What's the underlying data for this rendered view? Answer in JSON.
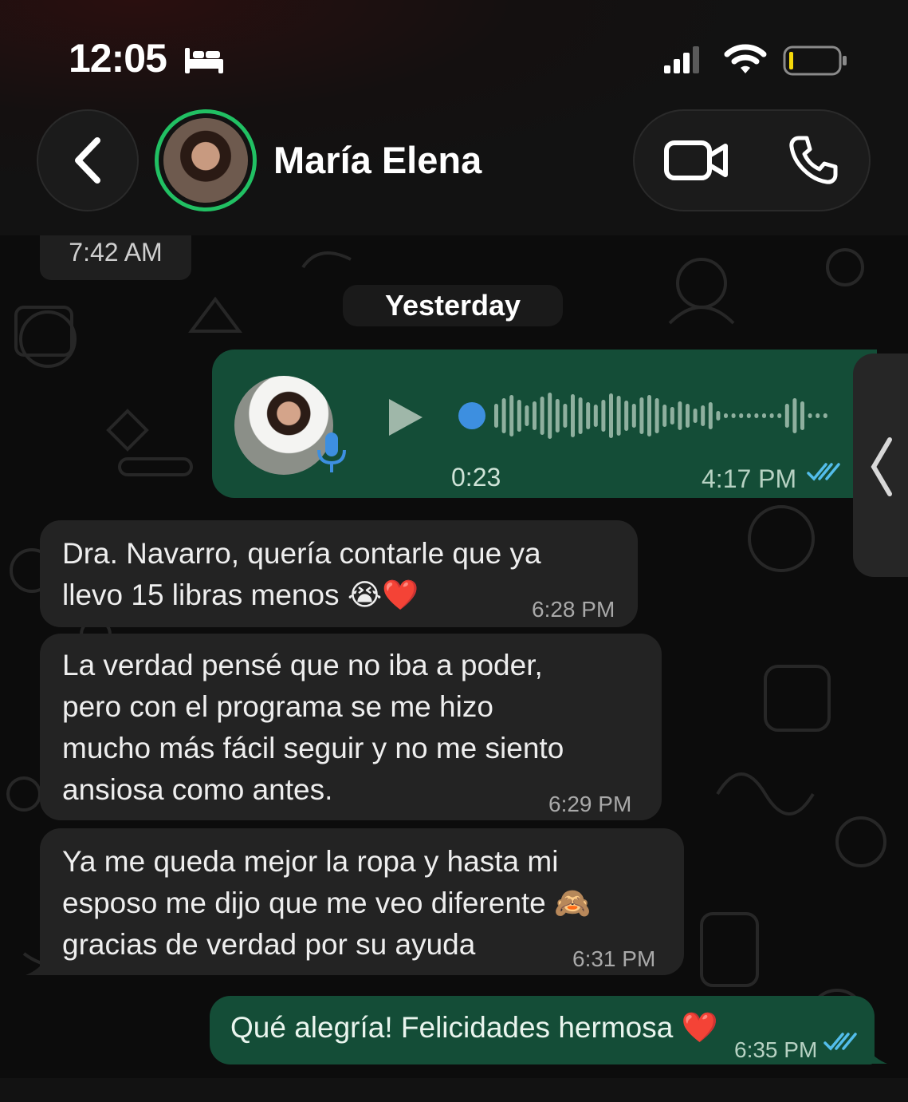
{
  "status_bar": {
    "time": "12:05"
  },
  "header": {
    "contact_name": "María Elena"
  },
  "chat": {
    "previous_time": "7:42 AM",
    "date_separator": "Yesterday",
    "voice_note": {
      "duration": "0:23",
      "time": "4:17 PM"
    },
    "messages": [
      {
        "lines": [
          "Dra. Navarro, quería contarle que ya",
          "llevo 15 libras menos 😭❤️"
        ],
        "time": "6:28 PM"
      },
      {
        "lines": [
          "La verdad pensé que no iba a poder,",
          "pero con el programa se me hizo",
          "mucho más fácil seguir y no me siento",
          "ansiosa como antes."
        ],
        "time": "6:29 PM"
      },
      {
        "lines": [
          "Ya me queda mejor la ropa y hasta mi",
          "esposo me dijo que me veo diferente 🙈",
          "gracias de verdad por su ayuda"
        ],
        "time": "6:31 PM"
      }
    ],
    "reply": {
      "text": "Qué alegría! Felicidades hermosa ❤️",
      "time": "6:35 PM"
    }
  },
  "colors": {
    "accent_green": "#21c063",
    "outgoing_bubble": "#144d37",
    "incoming_bubble": "#232323",
    "read_check": "#53bdeb"
  }
}
